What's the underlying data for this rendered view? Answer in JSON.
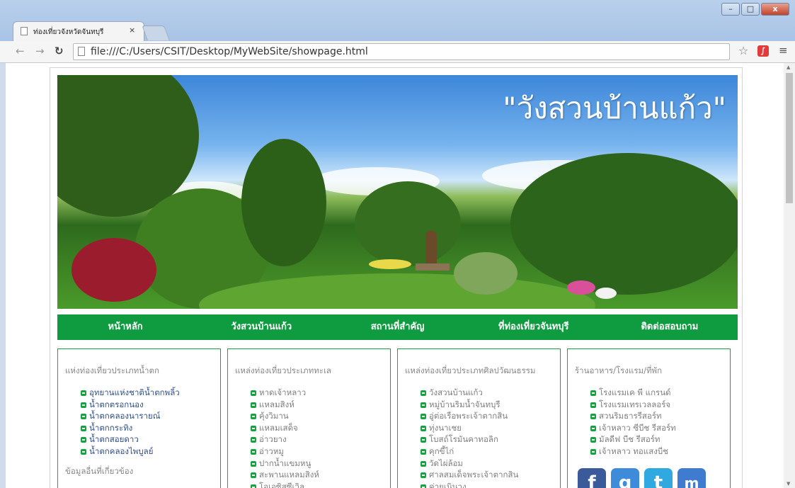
{
  "browser": {
    "tab_title": "ท่องเที่ยวจังหวัดจันทบุรี",
    "tab_close": "×",
    "url": "file:///C:/Users/CSIT/Desktop/MyWebSite/showpage.html",
    "min_label": "–",
    "max_label": "□",
    "close_label": "x"
  },
  "banner": {
    "title": "\"วังสวนบ้านแก้ว\""
  },
  "nav": {
    "items": [
      "หน้าหลัก",
      "วังสวนบ้านแก้ว",
      "สถานที่สำคัญ",
      "ที่ท่องเที่ยวจันทบุรี",
      "ติดต่อสอบถาม"
    ]
  },
  "boxes": [
    {
      "heading": "แห่งท่องเที่ยวประเภทน้ำตก",
      "items": [
        "อุทยานแห่งชาติน้ำตกพลิ้ว",
        "น้ำตกตรอกนอง",
        "น้ำตกคลองนารายณ์",
        "น้ำตกกระทิง",
        "น้ำตกสอยดาว",
        "น้ำตกคลองไพบูลย์"
      ],
      "subheading": "ข้อมูลอื่นที่เกี่ยวข้อง"
    },
    {
      "heading": "แหล่งท่องเที่ยวประเภททะเล",
      "items": [
        "หาดเจ้าหลาว",
        "แหลมสิงห์",
        "คุ้งวิมาน",
        "แหลมเสด็จ",
        "อ่าวยาง",
        "อ่าวหมู",
        "ปากน้ำแขมหนู",
        "สะพานแหลมสิงห์",
        "โอเอซิสซีเวิล"
      ]
    },
    {
      "heading": "แหล่งท่องเที่ยวประเภทศิลปวัฒนธรรม",
      "items": [
        "วังสวนบ้านแก้ว",
        "หมู่บ้านริมน้ำจันทบุรี",
        "อู่ต่อเรือพระเจ้าตากสิน",
        "ทุ่งนาเชย",
        "โบสถ์โรมันคาทอลิก",
        "คุกขี้ไก่",
        "วัดไผ่ล้อม",
        "ศาลสมเด็จพระเจ้าตากสิน",
        "ค่ายเนินวง"
      ]
    },
    {
      "heading": "ร้านอาหาร/โรงแรม/ที่พัก",
      "items": [
        "โรงแรมเค พี แกรนด์",
        "โรงแรมเทรเวลลอร์จ",
        "สวนริมธารรีสอร์ท",
        "เจ้าหลาว ซีบีช รีสอร์ท",
        "มัลดีฟ บีช รีสอร์ท",
        "เจ้าหลาว ทอแสงบีช"
      ],
      "social": [
        "f",
        "g",
        "t",
        "m"
      ]
    }
  ]
}
